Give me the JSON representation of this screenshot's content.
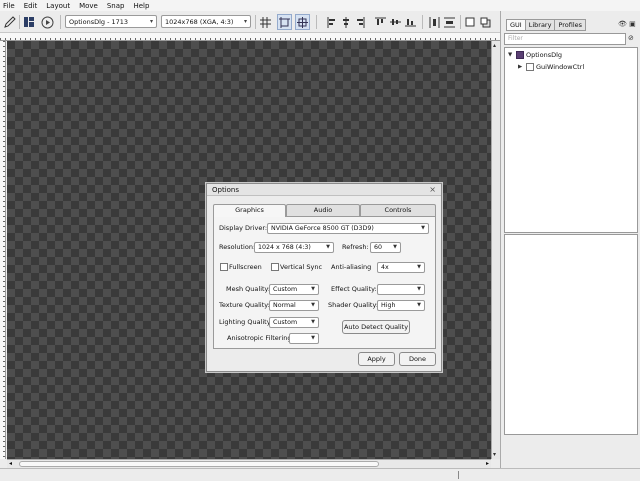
{
  "menu": [
    "File",
    "Edit",
    "Layout",
    "Move",
    "Snap",
    "Help"
  ],
  "toolbar": {
    "control_select": "OptionsDlg - 1713",
    "resolution_select": "1024x768 (XGA, 4:3)"
  },
  "dialog": {
    "title": "Options",
    "tabs": [
      "Graphics",
      "Audio",
      "Controls"
    ],
    "display_driver_label": "Display Driver:",
    "display_driver_value": "NVIDIA GeForce 8500 GT (D3D9)",
    "resolution_label": "Resolution:",
    "resolution_value": "1024 x 768  (4:3)",
    "refresh_label": "Refresh:",
    "refresh_value": "60",
    "fullscreen_label": "Fullscreen",
    "vsync_label": "Vertical Sync",
    "antialiasing_label": "Anti-aliasing",
    "antialiasing_value": "4x",
    "mesh_quality_label": "Mesh Quality:",
    "mesh_quality_value": "Custom",
    "effect_quality_label": "Effect Quality:",
    "effect_quality_value": "",
    "texture_quality_label": "Texture Quality:",
    "texture_quality_value": "Normal",
    "shader_quality_label": "Shader Quality:",
    "shader_quality_value": "High",
    "lighting_quality_label": "Lighting Quality:",
    "lighting_quality_value": "Custom",
    "auto_detect_label": "Auto Detect Quality",
    "anisotropic_label": "Anisotropic Filtering:",
    "anisotropic_value": "",
    "apply_label": "Apply",
    "done_label": "Done"
  },
  "side_panel": {
    "tabs": [
      "GUI",
      "Library",
      "Profiles"
    ],
    "filter_placeholder": "Filter",
    "tree": [
      {
        "label": "OptionsDlg"
      },
      {
        "label": "GuiWindowCtrl"
      }
    ]
  },
  "colors": {
    "canvas_dark": "#3a3a3a",
    "canvas_light": "#4e4e4e",
    "root_icon": "#5a3f73"
  }
}
